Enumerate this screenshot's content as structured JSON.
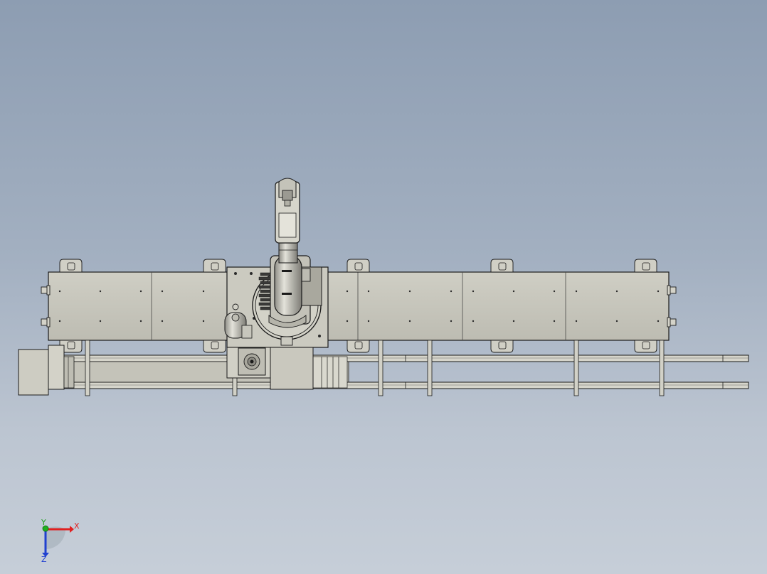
{
  "viewport": {
    "background_top": "#8d9db2",
    "background_bottom": "#c6ced8",
    "part_fill": "#c8c7bd",
    "part_fill_dark": "#a9a89e",
    "edge_color": "#1a1a1a"
  },
  "triad": {
    "x_label": "X",
    "y_label": "Y",
    "z_label": "Z",
    "x_color": "#e02020",
    "y_color": "#20b020",
    "z_color": "#2040d0"
  }
}
